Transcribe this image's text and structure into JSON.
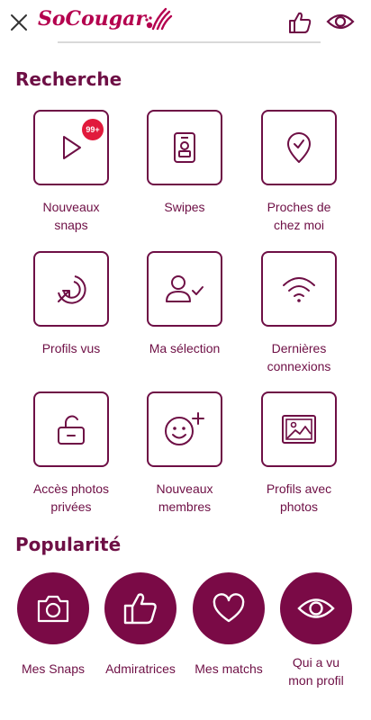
{
  "header": {
    "logo_text": "SoCougar",
    "close_icon": "close-icon",
    "like_icon": "thumbs-up-icon",
    "eye_icon": "eye-icon"
  },
  "colors": {
    "primary": "#6e0f45",
    "circle_fill": "#7a0a46",
    "logo": "#b4004e",
    "badge": "#e11a3c"
  },
  "recherche": {
    "title": "Recherche",
    "items": [
      {
        "label": "Nouveaux\nsnaps",
        "icon": "play-icon",
        "badge": "99+"
      },
      {
        "label": "Swipes",
        "icon": "id-badge-icon"
      },
      {
        "label": "Proches de\nchez moi",
        "icon": "location-check-icon"
      },
      {
        "label": "Profils vus",
        "icon": "target-cursor-icon"
      },
      {
        "label": "Ma sélection",
        "icon": "user-check-icon"
      },
      {
        "label": "Dernières\nconnexions",
        "icon": "wifi-icon"
      },
      {
        "label": "Accès photos\nprivées",
        "icon": "unlock-icon"
      },
      {
        "label": "Nouveaux\nmembres",
        "icon": "smiley-plus-icon"
      },
      {
        "label": "Profils avec\nphotos",
        "icon": "picture-icon"
      }
    ]
  },
  "popularite": {
    "title": "Popularité",
    "items": [
      {
        "label": "Mes Snaps",
        "icon": "camera-icon"
      },
      {
        "label": "Admiratrices",
        "icon": "thumbs-up-icon"
      },
      {
        "label": "Mes matchs",
        "icon": "heart-icon"
      },
      {
        "label": "Qui a vu\nmon profil",
        "icon": "eye-icon"
      }
    ]
  }
}
